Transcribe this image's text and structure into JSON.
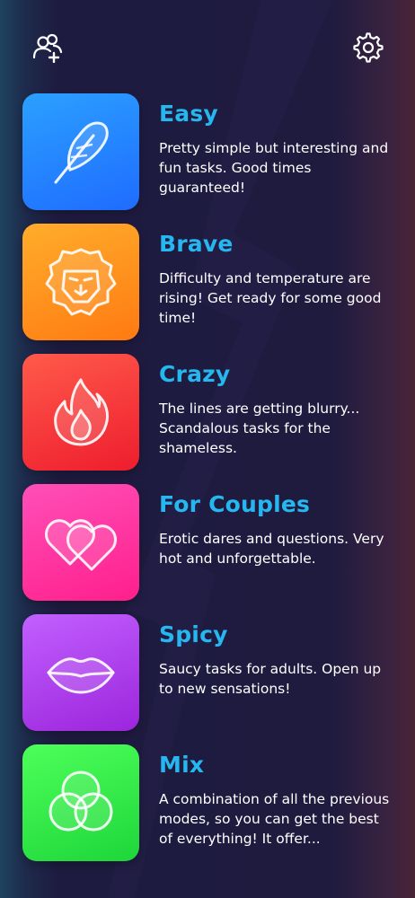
{
  "icons": {
    "add_friends": "user-plus-icon",
    "settings": "gear-icon"
  },
  "modes": [
    {
      "title": "Easy",
      "description": "Pretty simple but interesting and fun tasks. Good times guaranteed!",
      "icon": "feather-icon",
      "gradient": [
        "#2ba0ff",
        "#1f6cff"
      ]
    },
    {
      "title": "Brave",
      "description": "Difficulty and temperature are rising! Get ready for some good time!",
      "icon": "lion-icon",
      "gradient": [
        "#ffad2b",
        "#ff7a12"
      ]
    },
    {
      "title": "Crazy",
      "description": "The lines are getting blurry... Scandalous tasks for the shameless.",
      "icon": "fire-icon",
      "gradient": [
        "#ff5a4a",
        "#ee1d2e"
      ]
    },
    {
      "title": "For Couples",
      "description": "Erotic dares and questions. Very hot and unforgettable.",
      "icon": "hearts-icon",
      "gradient": [
        "#ff4fb8",
        "#ff1f8c"
      ]
    },
    {
      "title": "Spicy",
      "description": "Saucy tasks for adults. Open up to new sensations!",
      "icon": "lips-icon",
      "gradient": [
        "#c160ff",
        "#9c25dc"
      ]
    },
    {
      "title": "Mix",
      "description": "A combination of all the previous modes, so you can get the best of everything! It offer...",
      "icon": "circles-icon",
      "gradient": [
        "#4dff5a",
        "#1ed63a"
      ]
    }
  ]
}
